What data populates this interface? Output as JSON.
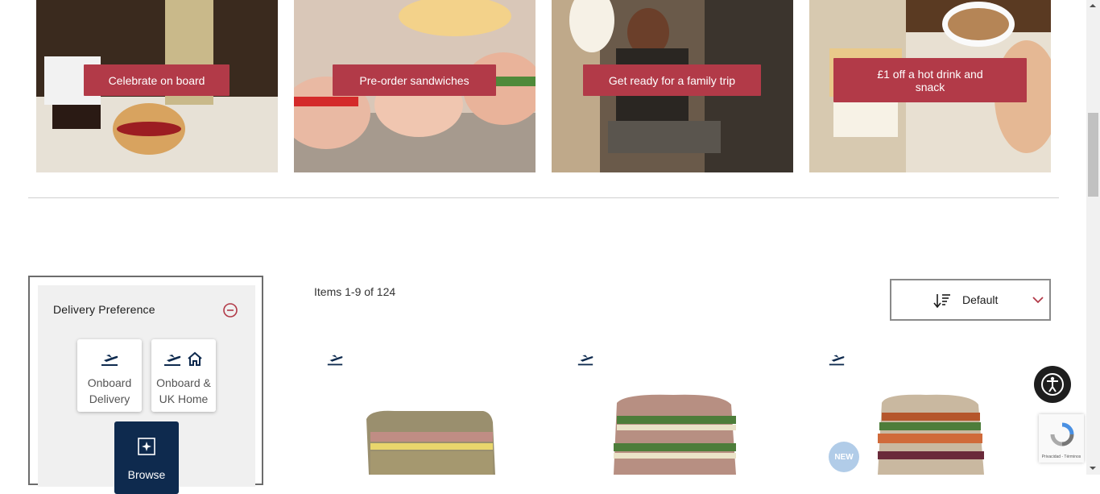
{
  "promos": [
    {
      "label": "Celebrate on board"
    },
    {
      "label": "Pre-order  sandwiches"
    },
    {
      "label": "Get ready for a family trip"
    },
    {
      "label": "£1 off a hot drink and snack"
    }
  ],
  "sidebar": {
    "title": "Delivery Preference",
    "options": [
      {
        "label_line1": "Onboard",
        "label_line2": "Delivery",
        "icon": "plane-takeoff-icon"
      },
      {
        "label_line1": "Onboard &",
        "label_line2": "UK Home",
        "icon": "plane-home-icon"
      },
      {
        "label_line1": "Browse",
        "icon": "browse-icon"
      }
    ]
  },
  "listing": {
    "count_text": "Items 1-9 of 124",
    "sort": {
      "selected": "Default"
    }
  },
  "products": [
    {
      "badge": ""
    },
    {
      "badge": ""
    },
    {
      "badge": "NEW"
    }
  ],
  "recaptcha": {
    "text": "Privacidad - Términos"
  },
  "colors": {
    "accent": "#b23a48",
    "navy": "#0e2a4e"
  }
}
